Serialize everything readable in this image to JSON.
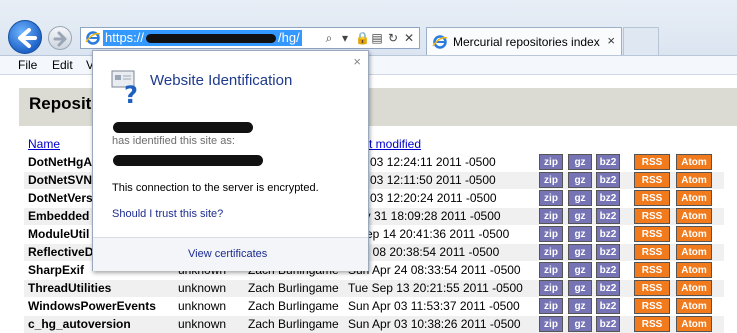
{
  "browser": {
    "url_prefix": "https://",
    "url_suffix": "/hg/",
    "tab_title": "Mercurial repositories index",
    "tab_close": "×"
  },
  "menu": {
    "file": "File",
    "edit": "Edit",
    "view": "V"
  },
  "page": {
    "heading": "Reposit",
    "columns": {
      "name": "Name",
      "last_modified": "t modified"
    },
    "archive_labels": [
      "zip",
      "gz",
      "bz2"
    ],
    "feed_labels": [
      "RSS",
      "Atom"
    ],
    "rows": [
      {
        "name": "DotNetHgA",
        "description": "",
        "contact": "",
        "modified": "Apr 03 12:24:11 2011 -0500"
      },
      {
        "name": "DotNetSVN",
        "description": "",
        "contact": "",
        "modified": "Apr 03 12:11:50 2011 -0500"
      },
      {
        "name": "DotNetVers",
        "description": "",
        "contact": "",
        "modified": "Apr 03 12:20:24 2011 -0500"
      },
      {
        "name": "Embedded",
        "description": "",
        "contact": "",
        "modified": "May 31 18:09:28 2011 -0500"
      },
      {
        "name": "ModuleUtil",
        "description": "",
        "contact": "",
        "modified": "d Sep 14 20:41:36 2011 -0500"
      },
      {
        "name": "ReflectiveD",
        "description": "",
        "contact": "",
        "modified": "Aug 08 20:38:54 2011 -0500"
      },
      {
        "name": "SharpExif",
        "description": "unknown",
        "contact": "Zach Burlingame",
        "modified": "Sun Apr 24 08:33:54 2011 -0500"
      },
      {
        "name": "ThreadUtilities",
        "description": "unknown",
        "contact": "Zach Burlingame",
        "modified": "Tue Sep 13 20:21:55 2011 -0500"
      },
      {
        "name": "WindowsPowerEvents",
        "description": "unknown",
        "contact": "Zach Burlingame",
        "modified": "Sun Apr 03 11:53:37 2011 -0500"
      },
      {
        "name": "c_hg_autoversion",
        "description": "unknown",
        "contact": "Zach Burlingame",
        "modified": "Sun Apr 03 10:38:26 2011 -0500"
      }
    ]
  },
  "popup": {
    "title": "Website Identification",
    "identified_text": "has identified this site as:",
    "encrypted_text": "This connection to the server is encrypted.",
    "trust_link": "Should I trust this site?",
    "certificates_link": "View certificates",
    "close": "×"
  },
  "colors": {
    "archive_button": "#7674b5",
    "feed_button": "#f07a1c",
    "link": "#1b2b8f",
    "url_selection": "#3399ff"
  }
}
